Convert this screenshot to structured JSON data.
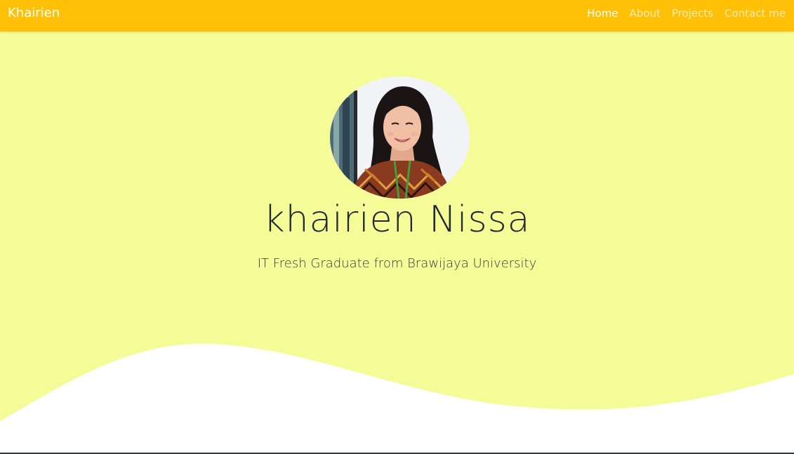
{
  "navbar": {
    "brand": "Khairien",
    "links": [
      {
        "label": "Home",
        "active": true
      },
      {
        "label": "About",
        "active": false
      },
      {
        "label": "Projects",
        "active": false
      },
      {
        "label": "Contact me",
        "active": false
      }
    ]
  },
  "hero": {
    "name": "khairien Nissa",
    "subtitle": "IT Fresh Graduate from Brawijaya University"
  },
  "colors": {
    "navbar_bg": "#ffc107",
    "hero_bg": "#f4fb97",
    "wave_fill": "#ffffff",
    "text_dark": "#222a30"
  }
}
